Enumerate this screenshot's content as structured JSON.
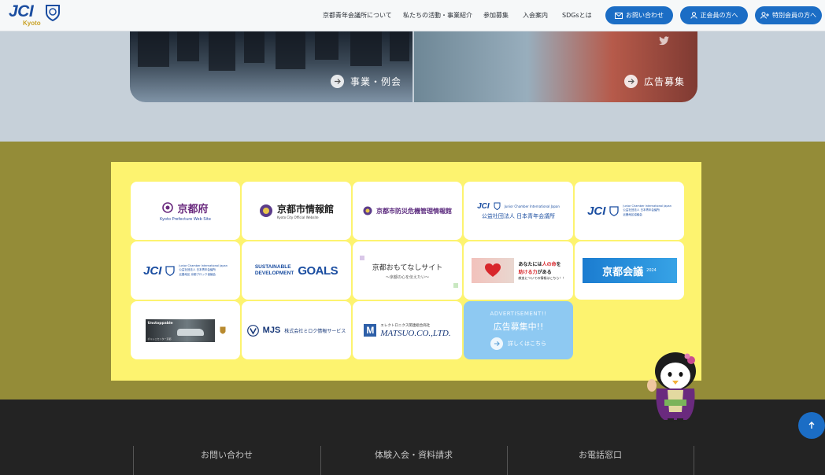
{
  "header": {
    "logo_text": "JCI",
    "logo_sub": "Kyoto",
    "nav": [
      "京都青年会議所について",
      "私たちの活動・事業紹介",
      "参加募集",
      "入会案内",
      "SDGsとは"
    ],
    "buttons": {
      "contact": "お問い合わせ",
      "member": "正会員の方へ",
      "special": "特別会員の方へ"
    },
    "accent": "#1b6dc5"
  },
  "banners": {
    "left_label": "事業・例会",
    "right_label": "広告募集"
  },
  "sponsors": {
    "kyoto_pref": {
      "title": "京都府",
      "sub": "Kyoto Prefecture Web Site"
    },
    "kyoto_city": {
      "title": "京都市情報館",
      "sub": "Kyoto City Official Website"
    },
    "bousai": {
      "title": "京都市防災危機管理情報館"
    },
    "jci_japan": {
      "title": "公益社団法人 日本青年会議所",
      "sub": "Junior Chamber International Japan"
    },
    "jci_kinki": {
      "title": "JCI",
      "sub": "Junior Chamber International Japan",
      "sub2": "公益社団法人 日本青年会議所",
      "sub3": "近畿地区協議会"
    },
    "jci_block": {
      "title": "JCI",
      "sub": "Junior Chamber International Japan",
      "sub2": "公益社団法人 日本青年会議所",
      "sub3": "近畿地区 京都ブロック協議会"
    },
    "sdgs": {
      "line1": "SUSTAINABLE",
      "line2": "DEVELOPMENT",
      "goals": "GOALS"
    },
    "omotenashi": {
      "title": "京都おもてなしサイト",
      "sub": "～京都の心を伝えたい～"
    },
    "blood": {
      "line1a": "あなたには",
      "line1b": "人の命",
      "line1c": "を",
      "line2a": "助ける力",
      "line2b": "がある",
      "line3": "献血についての情報はこちら！！"
    },
    "kaigi": {
      "title": "京都会議",
      "year": "2024"
    },
    "porsche": {
      "tag": "Unstoppable",
      "sub": "ポルシェセンター京都"
    },
    "mjs": {
      "logo": "MJS",
      "name": "株式会社ミロク情報サービス"
    },
    "matsuo": {
      "sub": "エレクトロニクス関連総合商社",
      "name": "MATSUO.CO.,LTD."
    },
    "ad": {
      "top": "ADVERTISEMENT!!",
      "title": "広告募集中!!",
      "link": "詳しくはこちら"
    }
  },
  "footer": {
    "items": [
      "お問い合わせ",
      "体験入会・資料請求",
      "お電話窓口"
    ]
  }
}
